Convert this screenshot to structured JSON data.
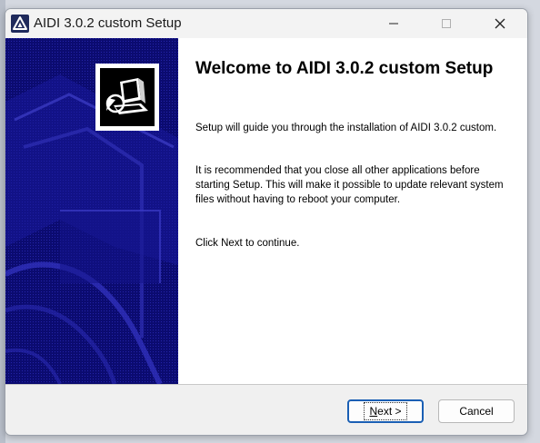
{
  "window": {
    "title": "AIDI 3.0.2 custom Setup",
    "accent_color": "#1a5fb4"
  },
  "titlebar": {
    "icons": [
      "app-logo-icon",
      "minimize-icon",
      "maximize-icon",
      "close-icon"
    ]
  },
  "banner": {
    "background_color": "#0a0a6a",
    "icon": "installer-computer-icon"
  },
  "content": {
    "heading": "Welcome to AIDI 3.0.2 custom Setup",
    "paragraph1": "Setup will guide you through the installation of AIDI 3.0.2 custom.",
    "paragraph2": "It is recommended that you close all other applications before starting Setup. This will make it possible to update relevant system files without having to reboot your computer.",
    "paragraph3": "Click Next to continue."
  },
  "buttons": {
    "next": {
      "mnemonic": "N",
      "rest": "ext >"
    },
    "cancel_label": "Cancel"
  }
}
